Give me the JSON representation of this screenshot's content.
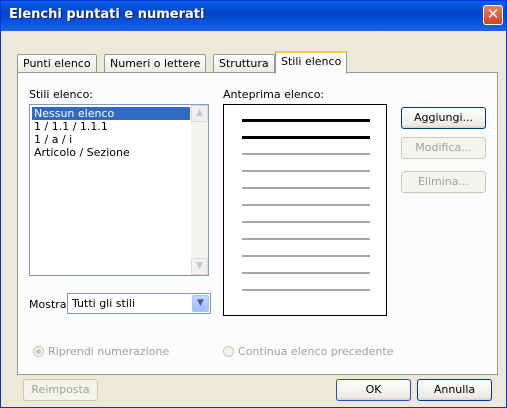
{
  "window": {
    "title": "Elenchi puntati e numerati"
  },
  "tabs": [
    {
      "label": "Punti elenco"
    },
    {
      "label": "Numeri o lettere"
    },
    {
      "label": "Struttura"
    },
    {
      "label": "Stili elenco",
      "active": true
    }
  ],
  "styles_list": {
    "label": "Stili elenco:",
    "items": [
      {
        "label": "Nessun elenco",
        "selected": true
      },
      {
        "label": "1 / 1.1 / 1.1.1"
      },
      {
        "label": "1 / a / i"
      },
      {
        "label": "Articolo / Sezione"
      }
    ]
  },
  "preview": {
    "label": "Anteprima elenco:",
    "lines": [
      {
        "style": "bold"
      },
      {
        "style": "bold"
      },
      {
        "style": "light"
      },
      {
        "style": "light"
      },
      {
        "style": "light"
      },
      {
        "style": "light"
      },
      {
        "style": "light"
      },
      {
        "style": "light"
      },
      {
        "style": "light"
      },
      {
        "style": "light"
      },
      {
        "style": "light"
      }
    ]
  },
  "buttons": {
    "add": "Aggiungi...",
    "modify": "Modifica...",
    "delete": "Elimina...",
    "reset": "Reimposta",
    "ok": "OK",
    "cancel": "Annulla"
  },
  "show": {
    "label": "Mostra:",
    "value": "Tutti gli stili"
  },
  "radios": {
    "restart": {
      "label": "Riprendi numerazione",
      "checked": true,
      "enabled": false
    },
    "continue": {
      "label": "Continua elenco precedente",
      "checked": false,
      "enabled": false
    }
  },
  "colors": {
    "title_bar": "#0A5FE8",
    "selection": "#316AC5",
    "dialog_bg": "#ECE9D8",
    "preview_bold": "#000000",
    "preview_light": "#A6A6A6"
  }
}
